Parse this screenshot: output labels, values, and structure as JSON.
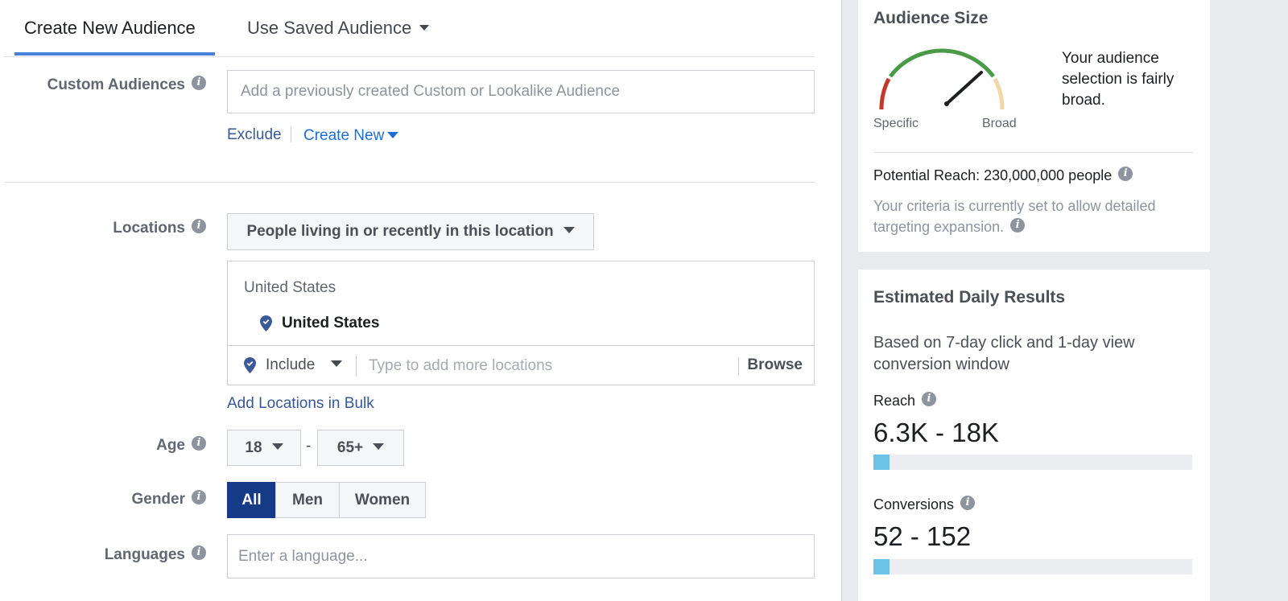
{
  "tabs": {
    "create_new": "Create New Audience",
    "use_saved": "Use Saved Audience"
  },
  "custom_audiences": {
    "label": "Custom Audiences",
    "placeholder": "Add a previously created Custom or Lookalike Audience",
    "exclude": "Exclude",
    "create_new": "Create New"
  },
  "locations": {
    "label": "Locations",
    "type_dropdown": "People living in or recently in this location",
    "group_header": "United States",
    "selected_item": "United States",
    "include_dropdown": "Include",
    "input_placeholder": "Type to add more locations",
    "browse": "Browse",
    "bulk_link": "Add Locations in Bulk"
  },
  "age": {
    "label": "Age",
    "min": "18",
    "separator": "-",
    "max": "65+"
  },
  "gender": {
    "label": "Gender",
    "options": [
      "All",
      "Men",
      "Women"
    ],
    "selected": "All"
  },
  "languages": {
    "label": "Languages",
    "placeholder": "Enter a language..."
  },
  "audience_size": {
    "title": "Audience Size",
    "gauge_left": "Specific",
    "gauge_right": "Broad",
    "description": "Your audience selection is fairly broad.",
    "potential_reach": "Potential Reach: 230,000,000 people",
    "criteria_note": "Your criteria is currently set to allow detailed targeting expansion.",
    "colors": {
      "specific": "#c0392b",
      "middle": "#4a9a48",
      "broad": "#f0d7a8"
    }
  },
  "estimated_daily": {
    "title": "Estimated Daily Results",
    "description": "Based on 7-day click and 1-day view conversion window",
    "reach_label": "Reach",
    "reach_value": "6.3K - 18K",
    "reach_bar_fraction": 0.05,
    "conversions_label": "Conversions",
    "conversions_value": "52 - 152",
    "conversions_bar_fraction": 0.05,
    "bar_color": "#6bc4e8"
  },
  "icons": [
    "info-icon",
    "location-pin-icon",
    "chevron-down-icon"
  ]
}
